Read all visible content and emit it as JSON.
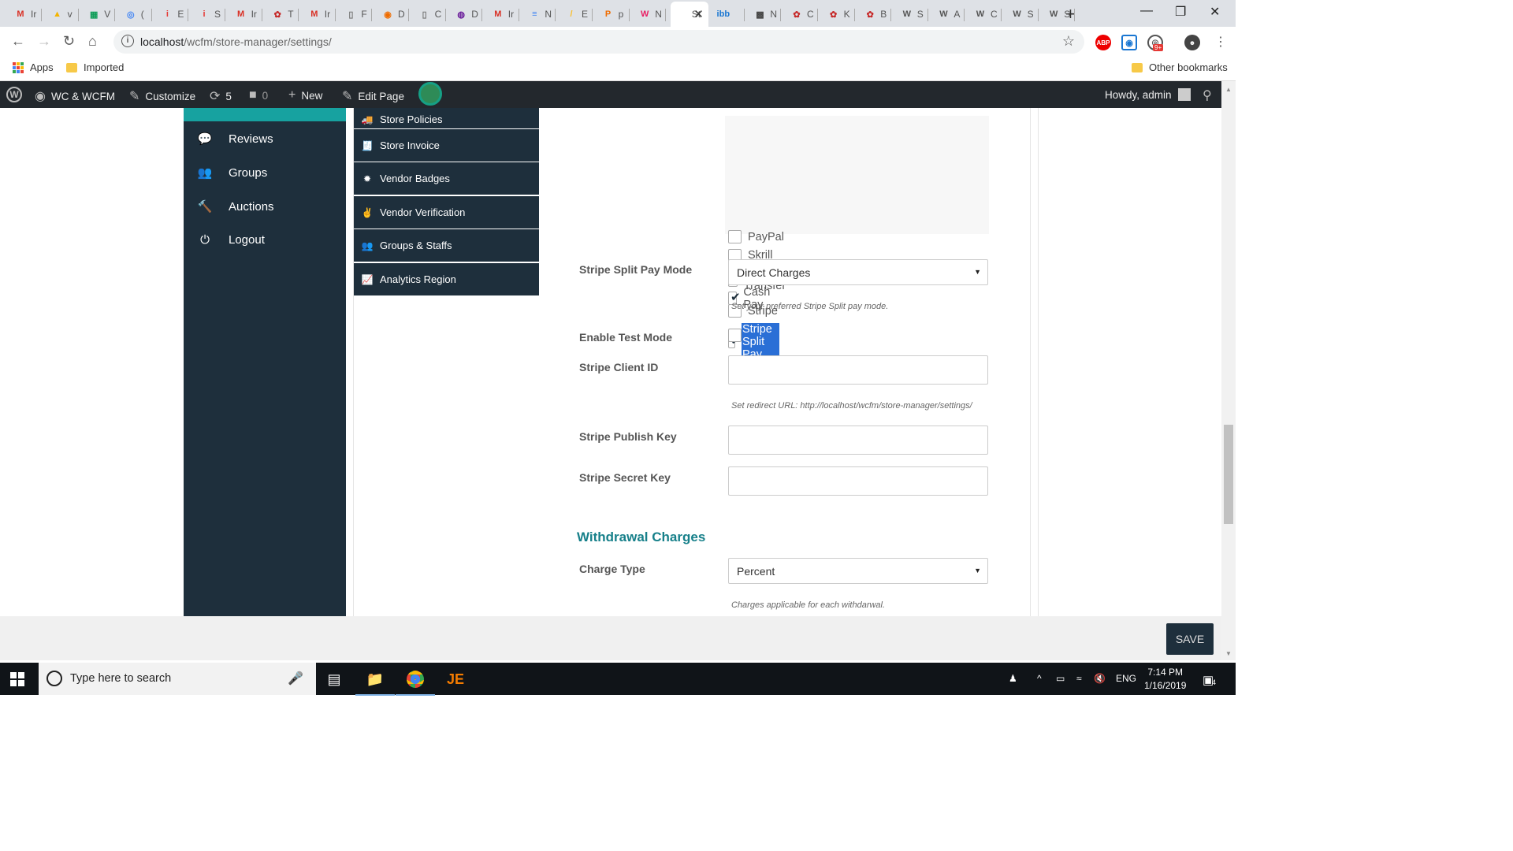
{
  "browser": {
    "tabs": [
      {
        "icon": "gmail-icon",
        "letter": "M",
        "color": "#d93025",
        "title": "Ir"
      },
      {
        "icon": "drive-icon",
        "letter": "▲",
        "color": "#f4b400",
        "title": "v"
      },
      {
        "icon": "sheets-icon",
        "letter": "▦",
        "color": "#0f9d58",
        "title": "V"
      },
      {
        "icon": "inbox-icon",
        "letter": "◎",
        "color": "#4285f4",
        "title": "("
      },
      {
        "icon": "i-icon",
        "letter": "i",
        "color": "#e53935",
        "title": "E"
      },
      {
        "icon": "i-icon",
        "letter": "i",
        "color": "#e53935",
        "title": "S"
      },
      {
        "icon": "gmail-icon",
        "letter": "M",
        "color": "#d93025",
        "title": "Ir"
      },
      {
        "icon": "leaf-icon",
        "letter": "✿",
        "color": "#c62828",
        "title": "T"
      },
      {
        "icon": "gmail-icon",
        "letter": "M",
        "color": "#d93025",
        "title": "Ir"
      },
      {
        "icon": "doc-icon",
        "letter": "▯",
        "color": "#777",
        "title": "F"
      },
      {
        "icon": "orange-icon",
        "letter": "◉",
        "color": "#ef6c00",
        "title": "D"
      },
      {
        "icon": "doc-icon",
        "letter": "▯",
        "color": "#777",
        "title": "C"
      },
      {
        "icon": "globe-icon",
        "letter": "◍",
        "color": "#6a1b9a",
        "title": "D"
      },
      {
        "icon": "gmail-icon",
        "letter": "M",
        "color": "#d93025",
        "title": "Ir"
      },
      {
        "icon": "docs-icon",
        "letter": "≡",
        "color": "#4285f4",
        "title": "N"
      },
      {
        "icon": "stripes-icon",
        "letter": "/",
        "color": "#fbc02d",
        "title": "E"
      },
      {
        "icon": "pma-icon",
        "letter": "P",
        "color": "#ef6c00",
        "title": "p"
      },
      {
        "icon": "wcfm-icon",
        "letter": "W",
        "color": "#e91e63",
        "title": "N"
      },
      {
        "icon": "st-icon",
        "letter": "S",
        "color": "#fff",
        "title": "St",
        "active": true
      },
      {
        "icon": "ibb-icon",
        "letter": "ibb",
        "color": "#1976d2",
        "title": ""
      },
      {
        "icon": "book-icon",
        "letter": "▩",
        "color": "#424242",
        "title": "N"
      },
      {
        "icon": "leaf-icon",
        "letter": "✿",
        "color": "#c62828",
        "title": "C"
      },
      {
        "icon": "leaf-icon",
        "letter": "✿",
        "color": "#c62828",
        "title": "K"
      },
      {
        "icon": "leaf-icon",
        "letter": "✿",
        "color": "#c62828",
        "title": "B"
      },
      {
        "icon": "wordpress-icon",
        "letter": "W",
        "color": "#555",
        "title": "S"
      },
      {
        "icon": "wordpress-icon",
        "letter": "W",
        "color": "#555",
        "title": "A"
      },
      {
        "icon": "wordpress-icon",
        "letter": "W",
        "color": "#555",
        "title": "C"
      },
      {
        "icon": "wordpress-icon",
        "letter": "W",
        "color": "#555",
        "title": "S"
      },
      {
        "icon": "wordpress-icon",
        "letter": "W",
        "color": "#555",
        "title": "S"
      }
    ],
    "url_host": "localhost",
    "url_path": "/wcfm/store-manager/settings/",
    "bookmarks": {
      "apps": "Apps",
      "imported": "Imported",
      "other": "Other bookmarks"
    },
    "abp_label": "ABP",
    "notif_badge": "9+"
  },
  "wpbar": {
    "site_name": "WC & WCFM",
    "customize": "Customize",
    "updates_count": "5",
    "comments_count": "0",
    "new_label": "New",
    "edit_page": "Edit Page",
    "howdy": "Howdy, admin"
  },
  "sidebar": {
    "items": [
      {
        "label": "Reviews",
        "icon": "reviews-icon",
        "glyph": "💬"
      },
      {
        "label": "Groups",
        "icon": "groups-icon",
        "glyph": "👥"
      },
      {
        "label": "Auctions",
        "icon": "gavel-icon",
        "glyph": "🔨"
      },
      {
        "label": "Logout",
        "icon": "power-icon",
        "glyph": "⏻"
      }
    ]
  },
  "submenu": {
    "items": [
      {
        "label": "Store Policies",
        "icon": "truck-icon",
        "glyph": "🚚"
      },
      {
        "label": "Store Invoice",
        "icon": "invoice-icon",
        "glyph": "🧾"
      },
      {
        "label": "Vendor Badges",
        "icon": "badge-icon",
        "glyph": "✹"
      },
      {
        "label": "Vendor Verification",
        "icon": "verification-icon",
        "glyph": "✌"
      },
      {
        "label": "Groups & Staffs",
        "icon": "staffs-icon",
        "glyph": "👥"
      },
      {
        "label": "Analytics Region",
        "icon": "analytics-icon",
        "glyph": "📈"
      }
    ]
  },
  "gateways": [
    {
      "label": "PayPal",
      "checked": false
    },
    {
      "label": "Skrill",
      "checked": false
    },
    {
      "label": "Bank Transfer",
      "checked": true
    },
    {
      "label": "Cash Pay",
      "checked": true
    },
    {
      "label": "Stripe",
      "checked": false
    },
    {
      "label": "Stripe Split Pay",
      "checked": true,
      "selected": true
    }
  ],
  "form": {
    "split_mode_label": "Stripe Split Pay Mode",
    "split_mode_value": "Direct Charges",
    "split_mode_hint": "Set your preferred Stripe Split pay mode.",
    "test_mode_label": "Enable Test Mode",
    "test_mode_checked": false,
    "client_id_label": "Stripe Client ID",
    "client_id_value": "",
    "redirect_hint": "Set redirect URL: http://localhost/wcfm/store-manager/settings/",
    "publish_key_label": "Stripe Publish Key",
    "publish_key_value": "",
    "secret_key_label": "Stripe Secret Key",
    "secret_key_value": "",
    "withdrawal_title": "Withdrawal Charges",
    "charge_type_label": "Charge Type",
    "charge_type_value": "Percent",
    "charge_type_hint": "Charges applicable for each withdarwal."
  },
  "save_label": "SAVE",
  "taskbar": {
    "search_placeholder": "Type here to search",
    "lang": "ENG",
    "time": "7:14 PM",
    "date": "1/16/2019",
    "notif_count": "4"
  },
  "colors": {
    "accent": "#17a2a0",
    "menu_bg": "#1e2f3c",
    "section_title": "#17808a"
  }
}
